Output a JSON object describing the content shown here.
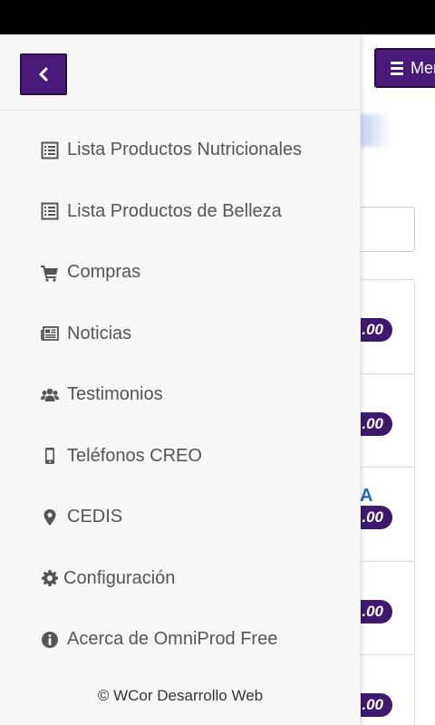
{
  "page": {
    "menu_label": "Mer",
    "price_labels": [
      ".00",
      ".00",
      ".00",
      ".00",
      ".00"
    ],
    "row_letter": "A"
  },
  "drawer": {
    "items": [
      {
        "label": "Lista Productos Nutricionales",
        "icon": "list-icon"
      },
      {
        "label": "Lista Productos de Belleza",
        "icon": "list-icon"
      },
      {
        "label": "Compras",
        "icon": "cart-icon"
      },
      {
        "label": "Noticias",
        "icon": "newspaper-icon"
      },
      {
        "label": "Testimonios",
        "icon": "users-icon"
      },
      {
        "label": "Teléfonos CREO",
        "icon": "mobile-icon"
      },
      {
        "label": "CEDIS",
        "icon": "map-marker-icon"
      },
      {
        "label": "Configuración",
        "icon": "gear-icon"
      },
      {
        "label": "Acerca de OmniProd Free",
        "icon": "info-icon"
      }
    ],
    "footer": "© WCor Desarrollo Web"
  },
  "colors": {
    "accent": "#4a1a7a",
    "price_pill": "#3d1a6e",
    "drawer_bg": "#f7f7f7",
    "text": "#555555"
  }
}
